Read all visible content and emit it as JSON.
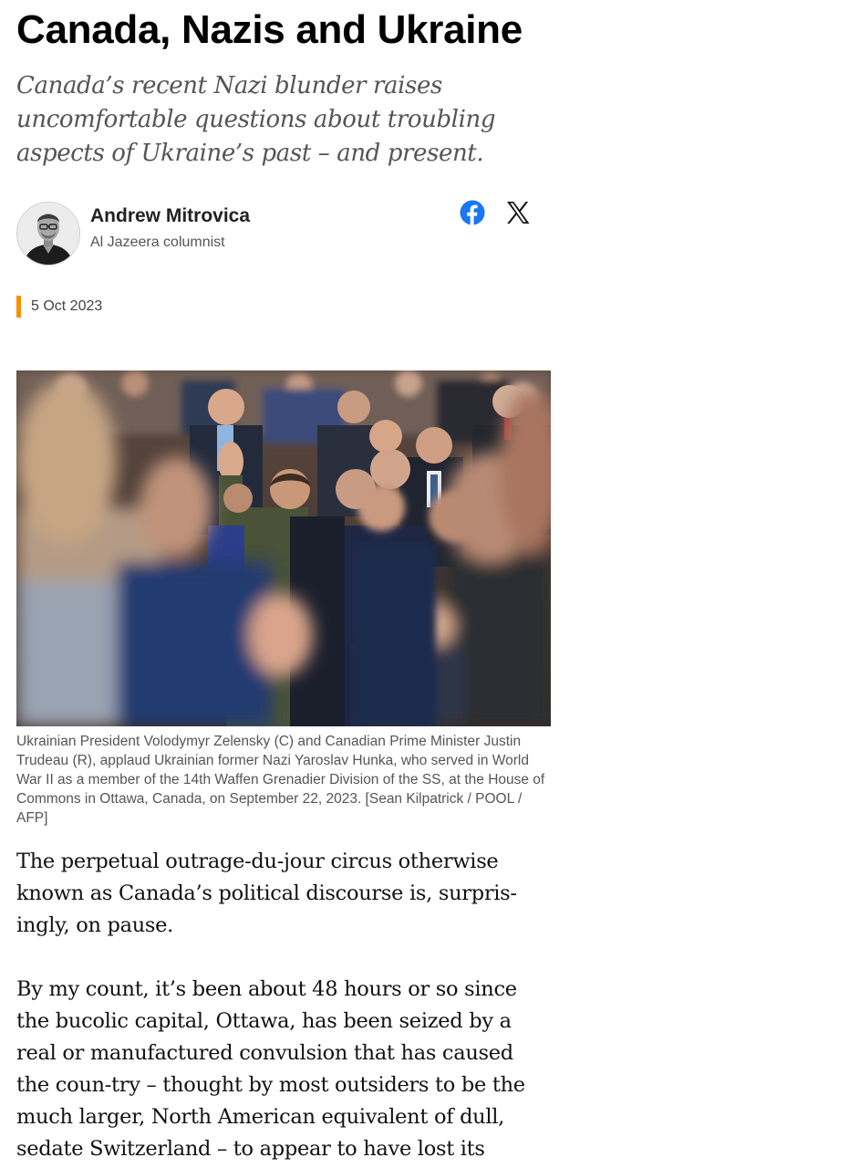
{
  "article": {
    "headline": "Canada, Nazis and Ukraine",
    "dek": "Canada’s recent Nazi blunder raises uncomfortable questions about troubling aspects of Ukraine’s past – and present.",
    "author": {
      "name": "Andrew Mitrovica",
      "role": "Al Jazeera columnist"
    },
    "share": {
      "facebook_icon": "facebook-icon",
      "x_icon": "x-twitter-icon"
    },
    "date": "5 Oct 2023",
    "accent_color": "#fa9000",
    "image_caption": "Ukrainian President Volodymyr Zelensky (C) and Canadian Prime Minister Justin Trudeau (R), applaud Ukrainian former Nazi Yaroslav Hunka, who served in World War II as a member of the 14th Waffen Grenadier Division of the SS, at the House of Commons in Ottawa, Canada, on September 22, 2023. [Sean Kilpatrick / POOL / AFP]",
    "paragraphs": [
      "The perpetual outrage-du-jour circus otherwise known as Canada’s political discourse is, surpris-ingly, on pause.",
      "By my count, it’s been about 48 hours or so since the bucolic capital, Ottawa, has been seized by a real or manufactured convulsion that has caused the coun-try – thought by most outsiders to be the much larger, North American equivalent of dull, sedate Switzerland – to appear to have lost its senses."
    ]
  }
}
